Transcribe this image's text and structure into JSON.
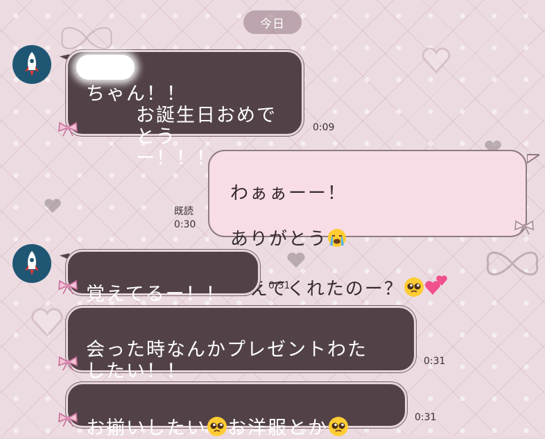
{
  "header": {
    "date_label": "今日"
  },
  "messages": [
    {
      "side": "in",
      "text": "ちゃん！！\nお誕生日おめでとう\nー！！！！！",
      "time": "0:09"
    },
    {
      "side": "out",
      "line1": "わぁぁーー！",
      "line2": "ありがとう",
      "line3": "覚えてくれたのー？",
      "read_label": "既読",
      "time": "0:30"
    },
    {
      "side": "in",
      "text": "覚えてるー！！",
      "time": "0:31"
    },
    {
      "side": "in",
      "text": "会った時なんかプレゼントわた\nしたい！！",
      "time": "0:31"
    },
    {
      "side": "in",
      "part1": "お揃いしたい",
      "part2": "お洋服とか",
      "time": "0:31"
    }
  ],
  "icons": {
    "avatar": "rocket-icon",
    "bubble_decoration": "ribbon-bow-icon",
    "emoji_crying": "loudly-crying-face-emoji",
    "emoji_pleading": "pleading-face-emoji",
    "emoji_hearts": "two-hearts-emoji"
  },
  "colors": {
    "background": "#ecdce2",
    "incoming_bubble": "#524248",
    "outgoing_bubble": "#f8dde6",
    "avatar": "#1f5673",
    "bow": "#d98bb0"
  }
}
